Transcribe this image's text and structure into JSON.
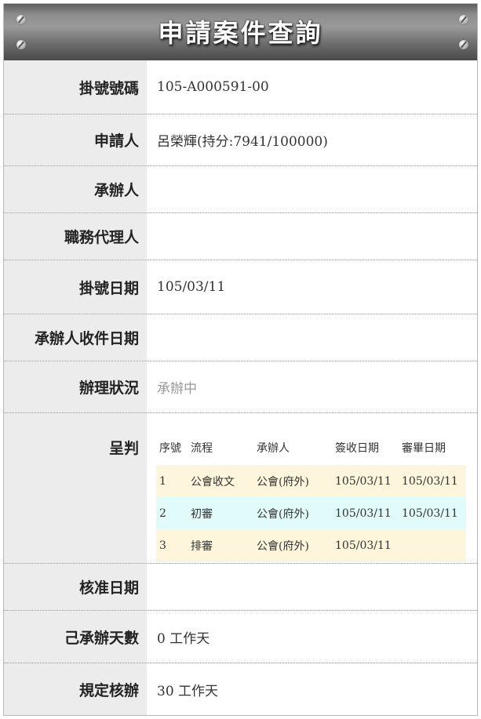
{
  "title": "申請案件查詢",
  "fields": {
    "case_number": {
      "label": "掛號號碼",
      "value": "105-A000591-00"
    },
    "applicant": {
      "label": "申請人",
      "value": "呂榮輝(持分:7941/100000)"
    },
    "handler": {
      "label": "承辦人",
      "value": ""
    },
    "deputy": {
      "label": "職務代理人",
      "value": ""
    },
    "register_date": {
      "label": "掛號日期",
      "value": "105/03/11"
    },
    "receive_date": {
      "label": "承辦人收件日期",
      "value": ""
    },
    "status": {
      "label": "辦理狀況",
      "value": "承辦中"
    },
    "approval_date": {
      "label": "核准日期",
      "value": ""
    },
    "days_elapsed": {
      "label": "己承辦天數",
      "value": "0 工作天"
    },
    "days_required": {
      "label": "規定核辦",
      "value": "30 工作天"
    }
  },
  "flow": {
    "label": "呈判",
    "headers": [
      "序號",
      "流程",
      "承辦人",
      "簽收日期",
      "審畢日期"
    ],
    "rows": [
      [
        "1",
        "公會收文",
        "公會(府外)",
        "105/03/11",
        "105/03/11"
      ],
      [
        "2",
        "初審",
        "公會(府外)",
        "105/03/11",
        "105/03/11"
      ],
      [
        "3",
        "排審",
        "公會(府外)",
        "105/03/11",
        ""
      ]
    ]
  },
  "colors": {
    "header_bg": "#7a7a7a",
    "label_bg": "#ececec",
    "row_odd": "#fdf5dc",
    "row_even": "#e1fbfb"
  },
  "icons": [
    "screw-icon"
  ]
}
